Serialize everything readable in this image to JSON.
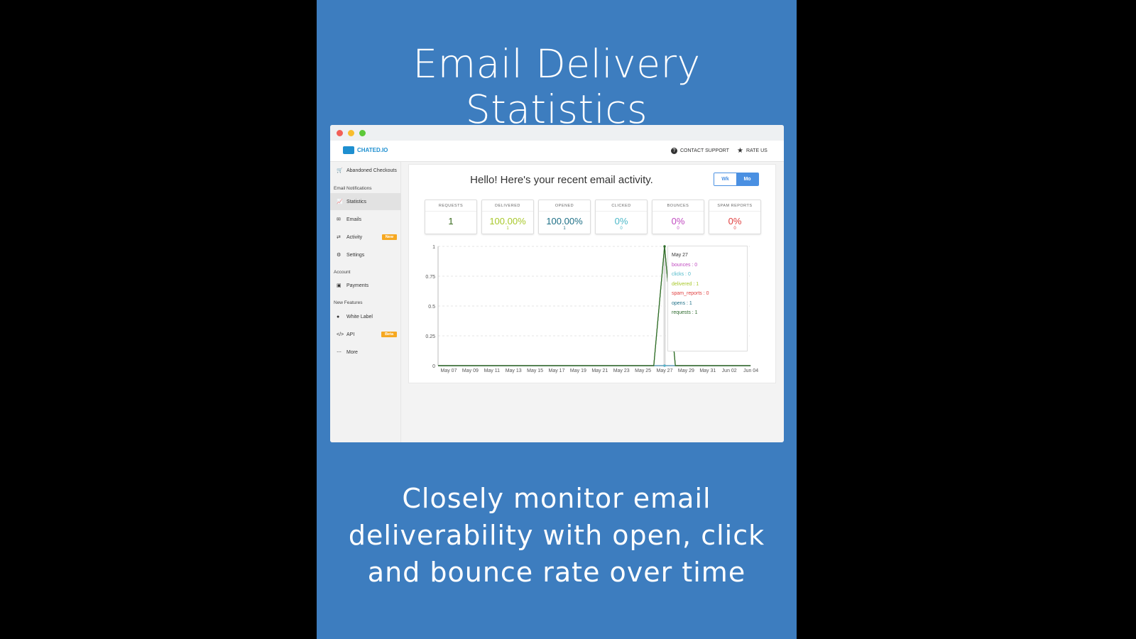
{
  "headline": "Email Delivery Statistics",
  "caption": "Closely monitor email deliverability with open, click and bounce rate over time",
  "app": {
    "logo": "CHATED.IO",
    "contact_support": "CONTACT SUPPORT",
    "rate_us": "RATE US"
  },
  "sidebar": {
    "abandoned": "Abandoned Checkouts",
    "sections": [
      "Email Notifications",
      "Account",
      "New Features"
    ],
    "items": [
      {
        "label": "Statistics",
        "icon": "chart-icon"
      },
      {
        "label": "Emails",
        "icon": "envelope-icon"
      },
      {
        "label": "Activity",
        "icon": "arrows-icon",
        "badge": "New"
      },
      {
        "label": "Settings",
        "icon": "gear-icon"
      },
      {
        "label": "Payments",
        "icon": "money-icon"
      },
      {
        "label": "White Label",
        "icon": "globe-icon"
      },
      {
        "label": "API",
        "icon": "code-icon",
        "badge": "Beta"
      },
      {
        "label": "More",
        "icon": "ellipsis-icon"
      }
    ]
  },
  "main": {
    "greeting": "Hello! Here's your recent email activity.",
    "toggle": [
      "Wk",
      "Mo"
    ],
    "selected": "Mo",
    "cards": [
      {
        "label": "REQUESTS",
        "value": "1",
        "sub": "",
        "color": "#3a6b1e"
      },
      {
        "label": "DELIVERED",
        "value": "100.00%",
        "sub": "1",
        "color": "#a8c82a"
      },
      {
        "label": "OPENED",
        "value": "100.00%",
        "sub": "1",
        "color": "#1d6f86"
      },
      {
        "label": "CLICKED",
        "value": "0%",
        "sub": "0",
        "color": "#4cb8c8"
      },
      {
        "label": "BOUNCES",
        "value": "0%",
        "sub": "0",
        "color": "#c04ac0"
      },
      {
        "label": "SPAM REPORTS",
        "value": "0%",
        "sub": "0",
        "color": "#e04040"
      }
    ]
  },
  "chart_data": {
    "type": "line",
    "x_ticks": [
      "May 07",
      "May 09",
      "May 11",
      "May 13",
      "May 15",
      "May 17",
      "May 19",
      "May 21",
      "May 23",
      "May 25",
      "May 27",
      "May 29",
      "May 31",
      "Jun 02",
      "Jun 04"
    ],
    "y_ticks": [
      "0",
      "0.25",
      "0.5",
      "0.75",
      "1"
    ],
    "ylim": [
      0,
      1
    ],
    "grid": true,
    "series": [
      {
        "name": "requests",
        "color": "#2e6b2e",
        "peak_date": "May 27",
        "peak_value": 1
      },
      {
        "name": "delivered",
        "color": "#a8c82a",
        "peak_date": "May 27",
        "peak_value": 1
      },
      {
        "name": "opens",
        "color": "#1d6f86",
        "peak_date": "May 27",
        "peak_value": 1
      },
      {
        "name": "clicks",
        "color": "#4cb8c8",
        "peak_date": "May 27",
        "peak_value": 0
      },
      {
        "name": "bounces",
        "color": "#c04ac0",
        "peak_date": "May 27",
        "peak_value": 0
      },
      {
        "name": "spam_reports",
        "color": "#e04040",
        "peak_date": "May 27",
        "peak_value": 0
      }
    ],
    "tooltip": {
      "date": "May 27",
      "rows": [
        {
          "label": "bounces : 0",
          "color": "#c04ac0"
        },
        {
          "label": "clicks : 0",
          "color": "#4cb8c8"
        },
        {
          "label": "delivered : 1",
          "color": "#a8c82a"
        },
        {
          "label": "spam_reports : 0",
          "color": "#e04040"
        },
        {
          "label": "opens : 1",
          "color": "#1d6f86"
        },
        {
          "label": "requests : 1",
          "color": "#2e6b2e"
        }
      ]
    }
  }
}
